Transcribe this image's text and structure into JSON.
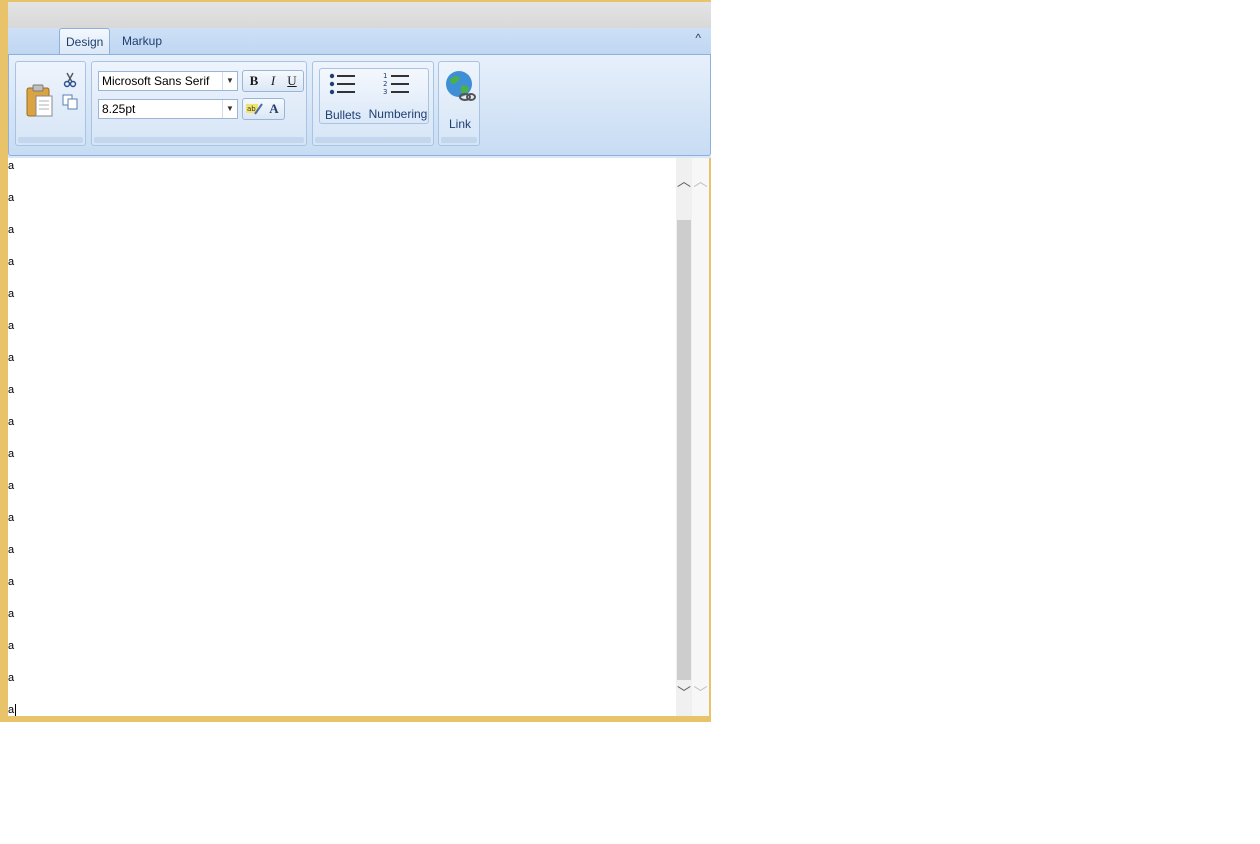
{
  "ribbon": {
    "tabs": [
      {
        "label": "Design",
        "active": true
      },
      {
        "label": "Markup",
        "active": false
      }
    ],
    "collapse_icon": "chevron-up-icon"
  },
  "font": {
    "family": "Microsoft Sans Serif",
    "size": "8.25pt"
  },
  "format_buttons": {
    "bold": "B",
    "italic": "I",
    "underline": "U",
    "font_color": "A"
  },
  "lists": {
    "bullets_label": "Bullets",
    "numbering_label": "Numbering"
  },
  "link": {
    "label": "Link"
  },
  "editor": {
    "lines": [
      "a",
      "a",
      "a",
      "a",
      "a",
      "a",
      "a",
      "a",
      "a",
      "a",
      "a",
      "a",
      "a",
      "a",
      "a",
      "a",
      "a",
      "a"
    ]
  },
  "colors": {
    "window_border": "#e8c36a",
    "ribbon_bg": "#d9e8f8",
    "label_text": "#1e3f70"
  }
}
